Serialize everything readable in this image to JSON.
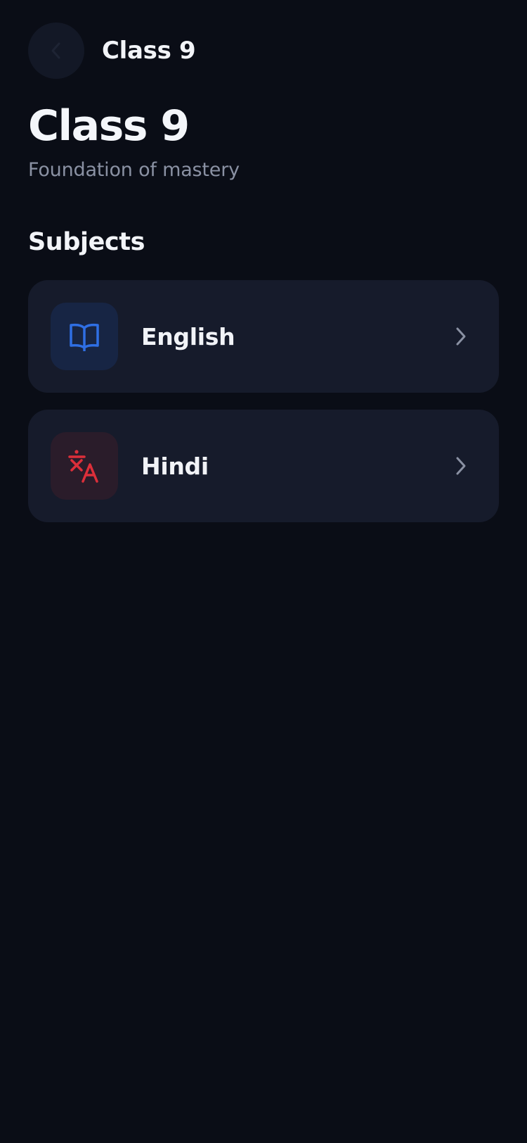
{
  "header": {
    "title": "Class 9"
  },
  "page": {
    "title": "Class 9",
    "subtitle": "Foundation of mastery"
  },
  "subjects_section": {
    "heading": "Subjects",
    "items": [
      {
        "label": "English",
        "icon": "book-open-icon",
        "accent": "#2f6fe4"
      },
      {
        "label": "Hindi",
        "icon": "translate-icon",
        "accent": "#dc2f3a"
      }
    ]
  },
  "colors": {
    "background": "#0a0d16",
    "card": "#161b2b",
    "text_primary": "#f1f3f7",
    "text_secondary": "#8a91a3"
  }
}
